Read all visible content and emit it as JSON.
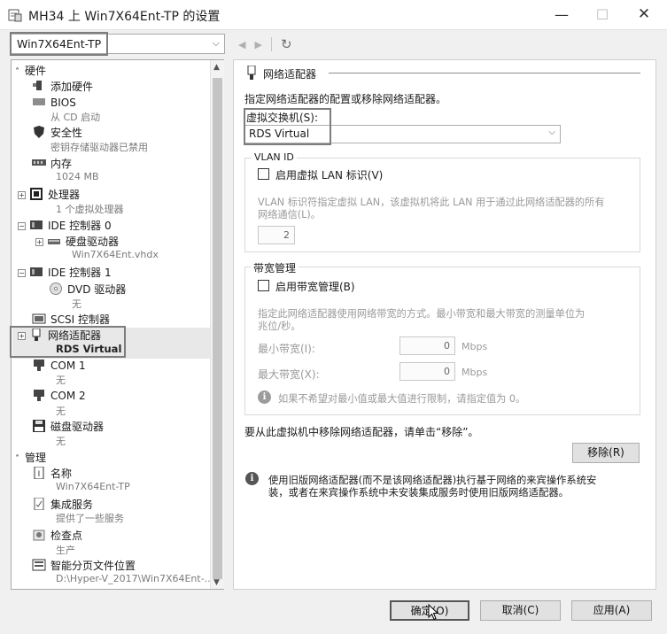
{
  "window": {
    "title": "MH34 上 Win7X64Ent-TP 的设置",
    "min_glyph": "—",
    "max_glyph": "☐",
    "close_glyph": "✕"
  },
  "vm_selector": {
    "value": "Win7X64Ent-TP",
    "chevron": "⌵"
  },
  "nav": {
    "back": "◀",
    "forward": "▶",
    "refresh": "↻"
  },
  "tree": {
    "hardware_header": "硬件",
    "management_header": "管理",
    "items": {
      "add_hardware": "添加硬件",
      "bios": "BIOS",
      "bios_sub": "从 CD 启动",
      "security": "安全性",
      "security_sub": "密钥存储驱动器已禁用",
      "memory": "内存",
      "memory_sub": "1024 MB",
      "processor": "处理器",
      "processor_sub": "1 个虚拟处理器",
      "ide0": "IDE 控制器 0",
      "hdd": "硬盘驱动器",
      "hdd_sub": "Win7X64Ent.vhdx",
      "ide1": "IDE 控制器 1",
      "dvd": "DVD 驱动器",
      "dvd_sub": "无",
      "scsi": "SCSI 控制器",
      "nic": "网络适配器",
      "nic_sub": "RDS Virtual",
      "com1": "COM 1",
      "com1_sub": "无",
      "com2": "COM 2",
      "com2_sub": "无",
      "floppy": "磁盘驱动器",
      "floppy_sub": "无",
      "name": "名称",
      "name_sub": "Win7X64Ent-TP",
      "integration": "集成服务",
      "integration_sub": "提供了一些服务",
      "checkpoint": "检查点",
      "checkpoint_sub": "生产",
      "paging": "智能分页文件位置",
      "paging_sub": "D:\\Hyper-V_2017\\Win7X64Ent-..."
    }
  },
  "panel": {
    "section_title": "网络适配器",
    "description": "指定网络适配器的配置或移除网络适配器。",
    "switch_label": "虚拟交换机(S):",
    "switch_value": "RDS Virtual",
    "vlan": {
      "legend": "VLAN ID",
      "checkbox_label": "启用虚拟 LAN 标识(V)",
      "help_line1": "VLAN 标识符指定虚拟 LAN，该虚拟机将此 LAN 用于通过此网络适配器的所有",
      "help_line2": "网络通信(L)。",
      "value": "2"
    },
    "bandwidth": {
      "legend": "带宽管理",
      "checkbox_label": "启用带宽管理(B)",
      "help_line1": "指定此网络适配器使用网络带宽的方式。最小带宽和最大带宽的测量单位为",
      "help_line2": "兆位/秒。",
      "min_label": "最小带宽(I):",
      "min_value": "0",
      "max_label": "最大带宽(X):",
      "max_value": "0",
      "unit": "Mbps",
      "note": "如果不希望对最小值或最大值进行限制，请指定值为 0。"
    },
    "remove_text": "要从此虚拟机中移除网络适配器，请单击“移除”。",
    "remove_button": "移除(R)",
    "legacy_line1": "使用旧版网络适配器(而不是该网络适配器)执行基于网络的来宾操作系统安",
    "legacy_line2": "装，或者在来宾操作系统中未安装集成服务时使用旧版网络适配器。"
  },
  "footer": {
    "ok": "确定(O)",
    "cancel": "取消(C)",
    "apply": "应用(A)"
  },
  "colors": {
    "selection": "#e8e8e8",
    "highlight_frame": "#7d7d7d"
  }
}
